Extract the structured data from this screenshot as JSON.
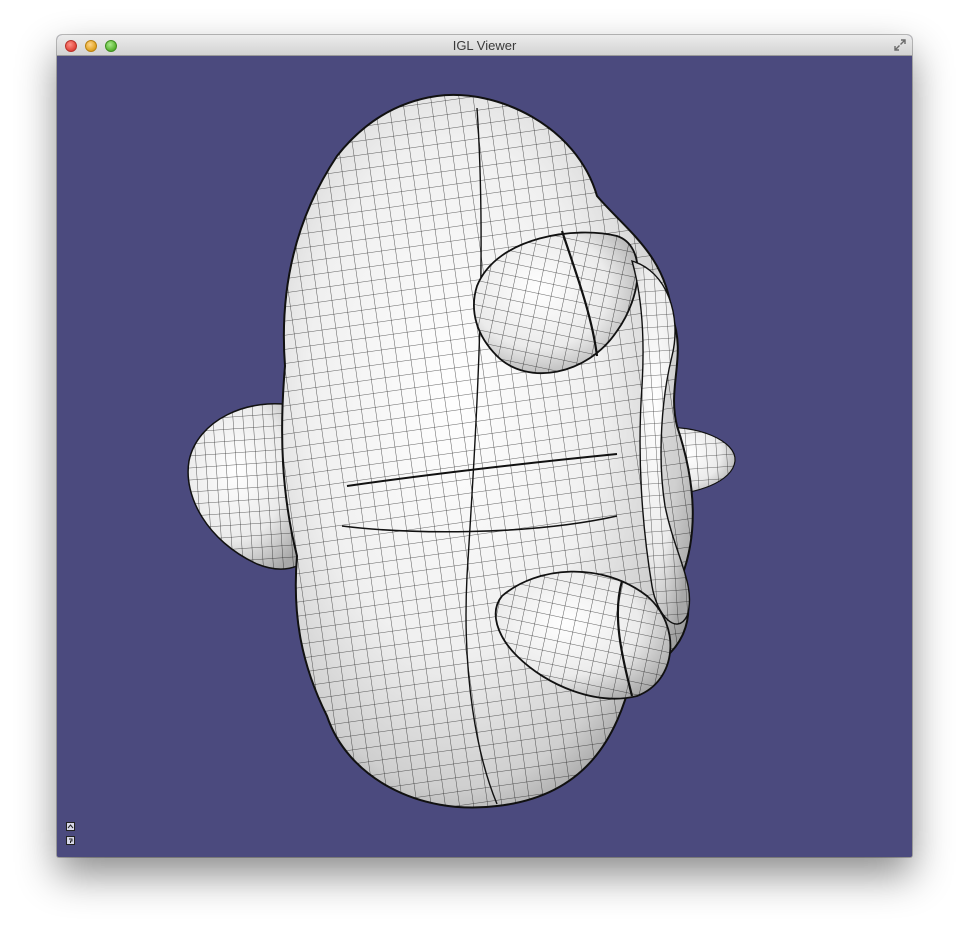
{
  "window": {
    "title": "IGL Viewer"
  },
  "colors": {
    "viewport_background": "#4b4a7e",
    "mesh_fill": "#f2f2f2",
    "mesh_lines": "#111111"
  },
  "icons": {
    "close": "close-icon",
    "minimize": "minimize-icon",
    "zoom": "zoom-icon",
    "fullscreen": "fullscreen-icon",
    "corner_top": "expand-icon",
    "corner_bottom": "settings-icon"
  }
}
